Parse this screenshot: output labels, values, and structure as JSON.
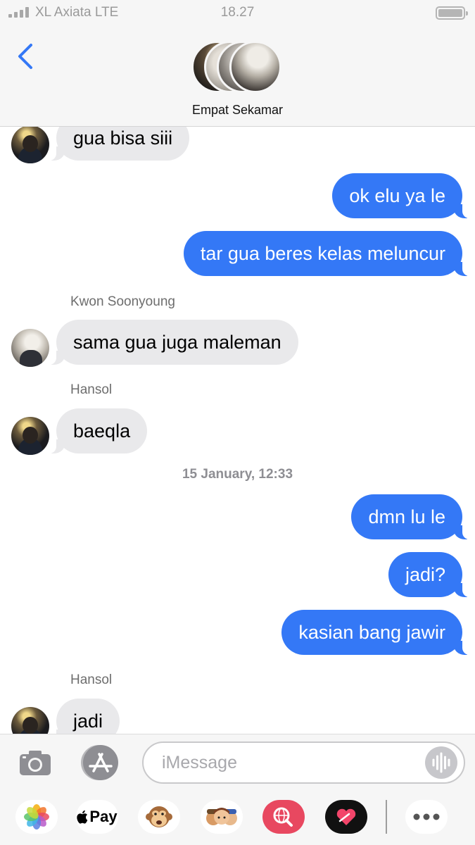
{
  "status_bar": {
    "carrier": "XL Axiata  LTE",
    "time": "18.27"
  },
  "header": {
    "group_name": "Empat Sekamar"
  },
  "messages": [
    {
      "direction": "in",
      "text": "gua bisa siii"
    },
    {
      "direction": "out",
      "text": "ok elu ya le"
    },
    {
      "direction": "out",
      "text": "tar gua beres kelas meluncur"
    },
    {
      "direction": "in",
      "sender": "Kwon Soonyoung",
      "text": "sama gua juga maleman"
    },
    {
      "direction": "in",
      "sender": "Hansol",
      "text": "baeqla"
    },
    {
      "timestamp": "15 January, 12:33"
    },
    {
      "direction": "out",
      "text": "dmn lu le"
    },
    {
      "direction": "out",
      "text": "jadi?"
    },
    {
      "direction": "out",
      "text": "kasian bang jawir"
    },
    {
      "direction": "in",
      "sender": "Hansol",
      "text": "jadi"
    }
  ],
  "composer": {
    "placeholder": "iMessage"
  },
  "app_drawer": {
    "apple_pay_label": "Pay"
  },
  "colors": {
    "outgoing": "#3478f6",
    "incoming": "#e9e9eb",
    "back_arrow": "#3478f6"
  }
}
